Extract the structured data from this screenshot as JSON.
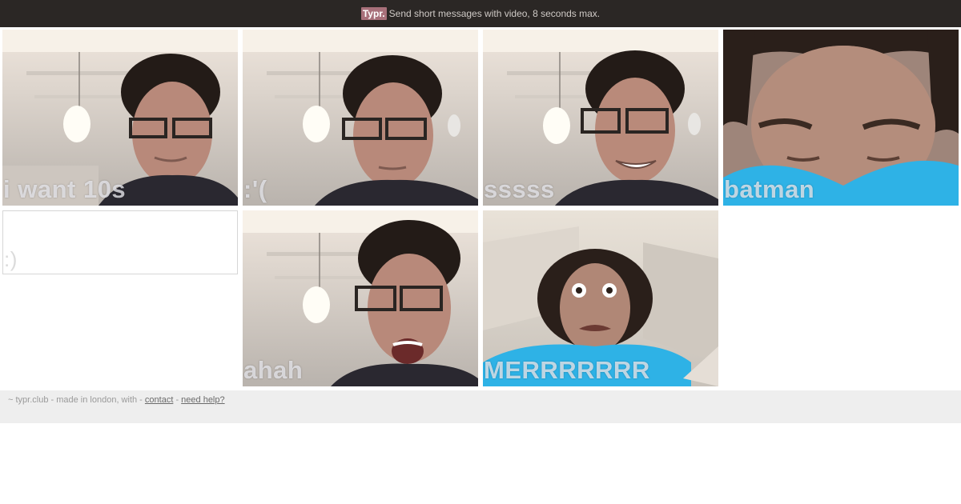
{
  "header": {
    "brand": "Typr.",
    "tagline": "Send short messages with video, 8 seconds max."
  },
  "tiles": [
    {
      "caption": "i want 10s",
      "scene": "room",
      "shirt": "#2a2830",
      "expression": "neutral"
    },
    {
      "caption": ":'(",
      "scene": "room",
      "shirt": "#2a2830",
      "expression": "down"
    },
    {
      "caption": "sssss",
      "scene": "room",
      "shirt": "#2a2830",
      "expression": "smile"
    },
    {
      "caption": "batman",
      "scene": "close",
      "shirt": "#2eb2e6",
      "expression": "close"
    },
    {
      "caption": ":)",
      "scene": "empty"
    },
    {
      "caption": "ahah",
      "scene": "room",
      "shirt": "#2a2830",
      "expression": "laugh"
    },
    {
      "caption": "MERRRRRRR",
      "scene": "wide",
      "shirt": "#2eb2e6",
      "expression": "funny"
    }
  ],
  "footer": {
    "text": "~ typr.club - made in london, with -",
    "contact_label": "contact",
    "separator": "-",
    "help_label": "need help?"
  },
  "colors": {
    "topbar": "#2b2725",
    "brand_bg": "#a8707a",
    "footer_bg": "#eeeeee",
    "blue_shirt": "#2eb2e6"
  }
}
